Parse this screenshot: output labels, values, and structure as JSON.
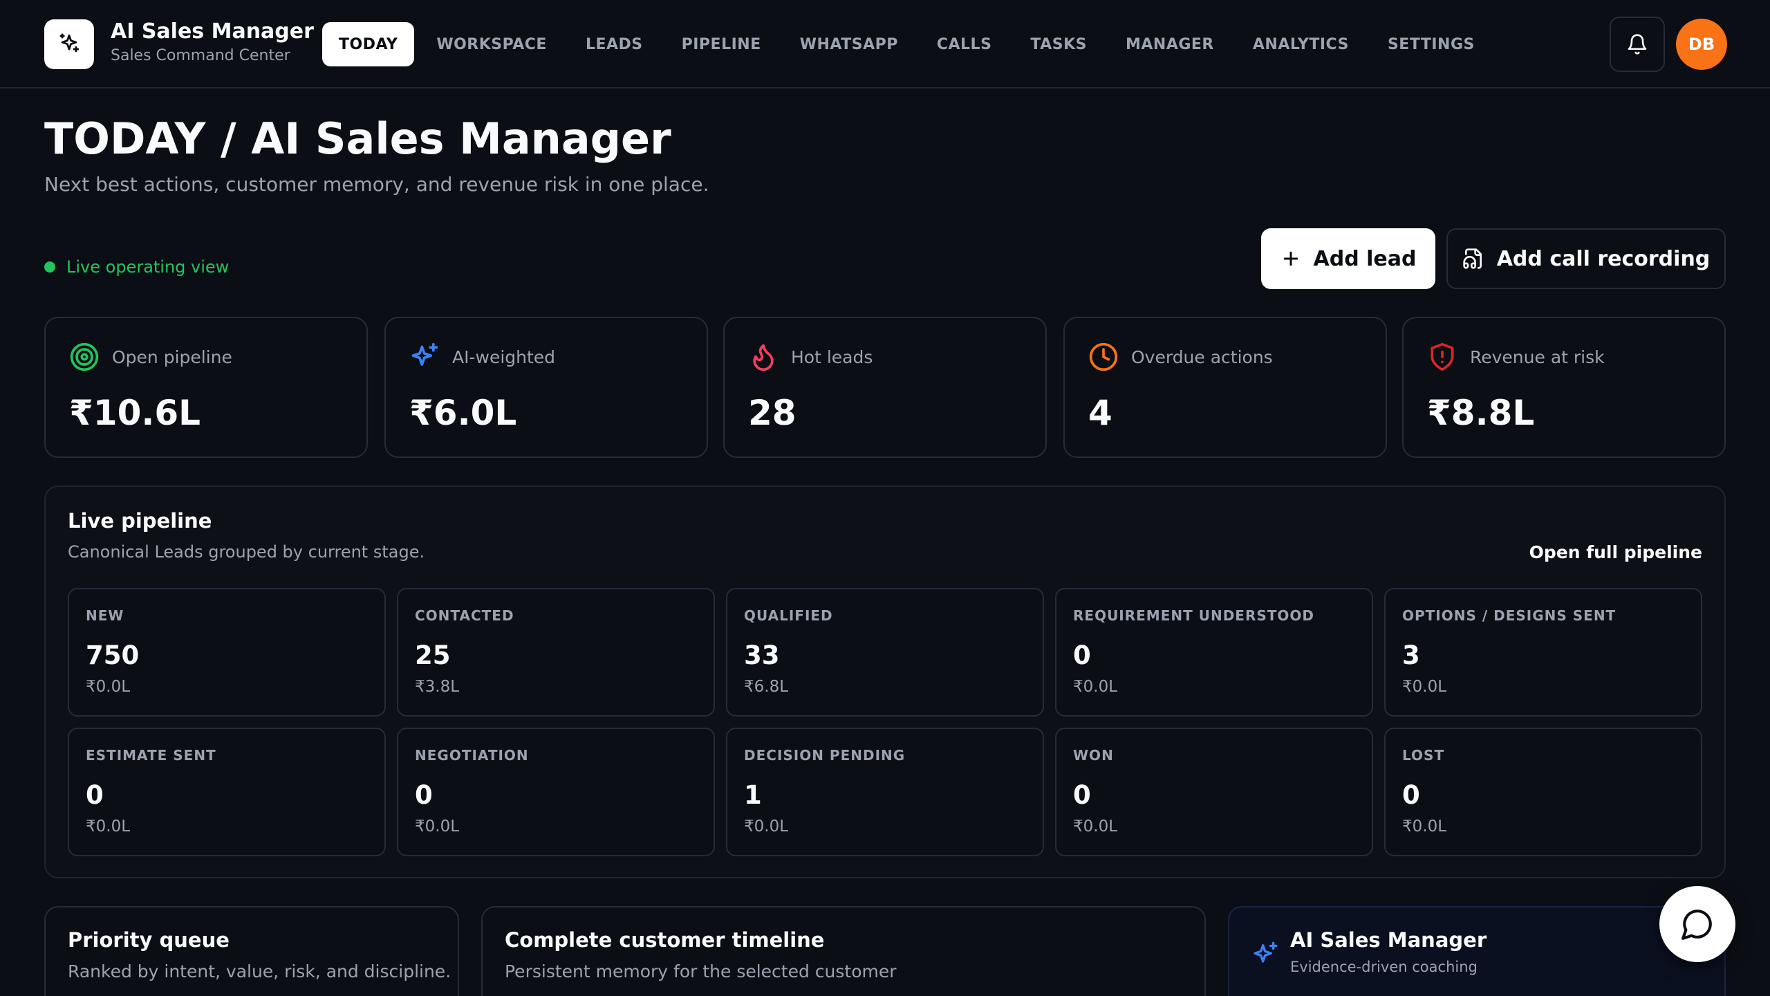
{
  "app": {
    "title": "AI Sales Manager",
    "subtitle": "Sales Command Center",
    "logo_icon": "sparkle-icon"
  },
  "nav": {
    "items": [
      {
        "label": "TODAY",
        "active": true
      },
      {
        "label": "WORKSPACE",
        "active": false
      },
      {
        "label": "LEADS",
        "active": false
      },
      {
        "label": "PIPELINE",
        "active": false
      },
      {
        "label": "WHATSAPP",
        "active": false
      },
      {
        "label": "CALLS",
        "active": false
      },
      {
        "label": "TASKS",
        "active": false
      },
      {
        "label": "MANAGER",
        "active": false
      },
      {
        "label": "ANALYTICS",
        "active": false
      },
      {
        "label": "SETTINGS",
        "active": false
      }
    ]
  },
  "user": {
    "initials": "DB",
    "avatar_color": "#f97316"
  },
  "page": {
    "title": "TODAY / AI Sales Manager",
    "subtitle": "Next best actions, customer memory, and revenue risk in one place.",
    "status": "Live operating view",
    "status_color": "#22c55e"
  },
  "actions": {
    "add_lead": "Add lead",
    "add_call_recording": "Add call recording"
  },
  "kpis": [
    {
      "label": "Open pipeline",
      "value": "₹10.6L",
      "icon": "target-icon",
      "color": "#22c55e"
    },
    {
      "label": "AI-weighted",
      "value": "₹6.0L",
      "icon": "sparkle-icon",
      "color": "#3b82f6"
    },
    {
      "label": "Hot leads",
      "value": "28",
      "icon": "flame-icon",
      "color": "#f43f5e"
    },
    {
      "label": "Overdue actions",
      "value": "4",
      "icon": "clock-icon",
      "color": "#f97316"
    },
    {
      "label": "Revenue at risk",
      "value": "₹8.8L",
      "icon": "shield-alert-icon",
      "color": "#dc2626"
    }
  ],
  "pipeline": {
    "title": "Live pipeline",
    "subtitle": "Canonical Leads grouped by current stage.",
    "link": "Open full pipeline",
    "stages": [
      {
        "name": "NEW",
        "count": "750",
        "amount": "₹0.0L"
      },
      {
        "name": "CONTACTED",
        "count": "25",
        "amount": "₹3.8L"
      },
      {
        "name": "QUALIFIED",
        "count": "33",
        "amount": "₹6.8L"
      },
      {
        "name": "REQUIREMENT UNDERSTOOD",
        "count": "0",
        "amount": "₹0.0L"
      },
      {
        "name": "OPTIONS / DESIGNS SENT",
        "count": "3",
        "amount": "₹0.0L"
      },
      {
        "name": "ESTIMATE SENT",
        "count": "0",
        "amount": "₹0.0L"
      },
      {
        "name": "NEGOTIATION",
        "count": "0",
        "amount": "₹0.0L"
      },
      {
        "name": "DECISION PENDING",
        "count": "1",
        "amount": "₹0.0L"
      },
      {
        "name": "WON",
        "count": "0",
        "amount": "₹0.0L"
      },
      {
        "name": "LOST",
        "count": "0",
        "amount": "₹0.0L"
      }
    ]
  },
  "priority_queue": {
    "title": "Priority queue",
    "subtitle": "Ranked by intent, value, risk, and discipline."
  },
  "timeline": {
    "title": "Complete customer timeline",
    "subtitle": "Persistent memory for the selected customer"
  },
  "ai_panel": {
    "title": "AI Sales Manager",
    "subtitle": "Evidence-driven coaching",
    "icon": "sparkle-icon"
  }
}
